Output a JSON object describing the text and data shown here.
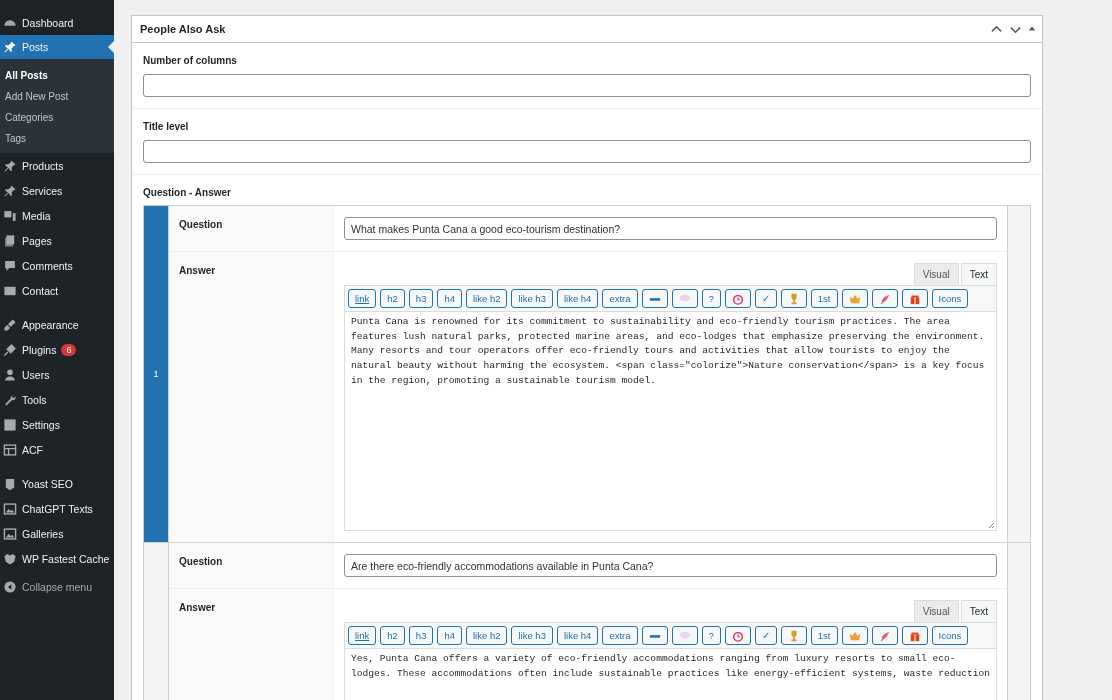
{
  "sidebar": {
    "groups": [
      [
        {
          "label": "Dashboard",
          "selected": false
        },
        {
          "label": "Posts",
          "selected": true,
          "submenu": [
            {
              "label": "All Posts",
              "selected": true
            },
            {
              "label": "Add New Post",
              "selected": false
            },
            {
              "label": "Categories",
              "selected": false
            },
            {
              "label": "Tags",
              "selected": false
            }
          ]
        },
        {
          "label": "Products",
          "selected": false
        },
        {
          "label": "Services",
          "selected": false
        },
        {
          "label": "Media",
          "selected": false
        },
        {
          "label": "Pages",
          "selected": false
        },
        {
          "label": "Comments",
          "selected": false
        },
        {
          "label": "Contact",
          "selected": false
        }
      ],
      [
        {
          "label": "Appearance",
          "selected": false
        },
        {
          "label": "Plugins",
          "selected": false,
          "badge": "6"
        },
        {
          "label": "Users",
          "selected": false
        },
        {
          "label": "Tools",
          "selected": false
        },
        {
          "label": "Settings",
          "selected": false
        },
        {
          "label": "ACF",
          "selected": false
        }
      ],
      [
        {
          "label": "Yoast SEO",
          "selected": false
        },
        {
          "label": "ChatGPT Texts",
          "selected": false
        },
        {
          "label": "Galleries",
          "selected": false
        },
        {
          "label": "WP Fastest Cache",
          "selected": false
        }
      ]
    ],
    "collapse": "Collapse menu"
  },
  "panel": {
    "title": "People Also Ask",
    "fields": [
      {
        "label": "Number of columns"
      },
      {
        "label": "Title level"
      }
    ],
    "repeater_label": "Question - Answer",
    "rows": [
      {
        "number": "1",
        "active": true,
        "question_label": "Question",
        "question": "What makes Punta Cana a good eco-tourism destination?",
        "answer_label": "Answer",
        "tabs": [
          {
            "label": "Visual",
            "selected": false
          },
          {
            "label": "Text",
            "selected": true
          }
        ],
        "toolbar": [
          {
            "kind": "link",
            "label": "link"
          },
          {
            "kind": "text",
            "label": "h2"
          },
          {
            "kind": "text",
            "label": "h3"
          },
          {
            "kind": "text",
            "label": "h4"
          },
          {
            "kind": "text",
            "label": "like h2"
          },
          {
            "kind": "text",
            "label": "like h3"
          },
          {
            "kind": "text",
            "label": "like h4"
          },
          {
            "kind": "text",
            "label": "extra"
          },
          {
            "kind": "icon"
          },
          {
            "kind": "icon"
          },
          {
            "kind": "text",
            "label": "?"
          },
          {
            "kind": "icon"
          },
          {
            "kind": "text",
            "label": "✓"
          },
          {
            "kind": "icon"
          },
          {
            "kind": "text",
            "label": "1st"
          },
          {
            "kind": "icon"
          },
          {
            "kind": "icon"
          },
          {
            "kind": "icon"
          },
          {
            "kind": "text",
            "label": "Icons"
          }
        ],
        "answer_lines": [
          "Punta Cana is renowned for its commitment to sustainability and eco-friendly tourism practices. The area",
          "features lush natural parks, protected marine areas, and eco-lodges that emphasize preserving the environment.",
          "Many resorts and tour operators offer eco-friendly tours and activities that allow tourists to enjoy the",
          "natural beauty without harming the ecosystem. <span class=\"colorize\">Nature conservation</span> is a key focus",
          "in the region, promoting a sustainable tourism model."
        ]
      },
      {
        "active": false,
        "question_label": "Question",
        "question": "Are there eco-friendly accommodations available in Punta Cana?",
        "answer_label": "Answer",
        "tabs": [
          {
            "label": "Visual",
            "selected": false
          },
          {
            "label": "Text",
            "selected": true
          }
        ],
        "toolbar": [
          {
            "kind": "link",
            "label": "link"
          },
          {
            "kind": "text",
            "label": "h2"
          },
          {
            "kind": "text",
            "label": "h3"
          },
          {
            "kind": "text",
            "label": "h4"
          },
          {
            "kind": "text",
            "label": "like h2"
          },
          {
            "kind": "text",
            "label": "like h3"
          },
          {
            "kind": "text",
            "label": "like h4"
          },
          {
            "kind": "text",
            "label": "extra"
          },
          {
            "kind": "icon"
          },
          {
            "kind": "icon"
          },
          {
            "kind": "text",
            "label": "?"
          },
          {
            "kind": "icon"
          },
          {
            "kind": "text",
            "label": "✓"
          },
          {
            "kind": "icon"
          },
          {
            "kind": "text",
            "label": "1st"
          },
          {
            "kind": "icon"
          },
          {
            "kind": "icon"
          },
          {
            "kind": "icon"
          },
          {
            "kind": "text",
            "label": "Icons"
          }
        ],
        "answer_lines": [
          "Yes, Punta Cana offers a variety of eco-friendly accommodations ranging from luxury resorts to small eco-",
          "lodges. These accommodations often include sustainable practices like energy-efficient systems, waste reduction"
        ]
      }
    ]
  }
}
